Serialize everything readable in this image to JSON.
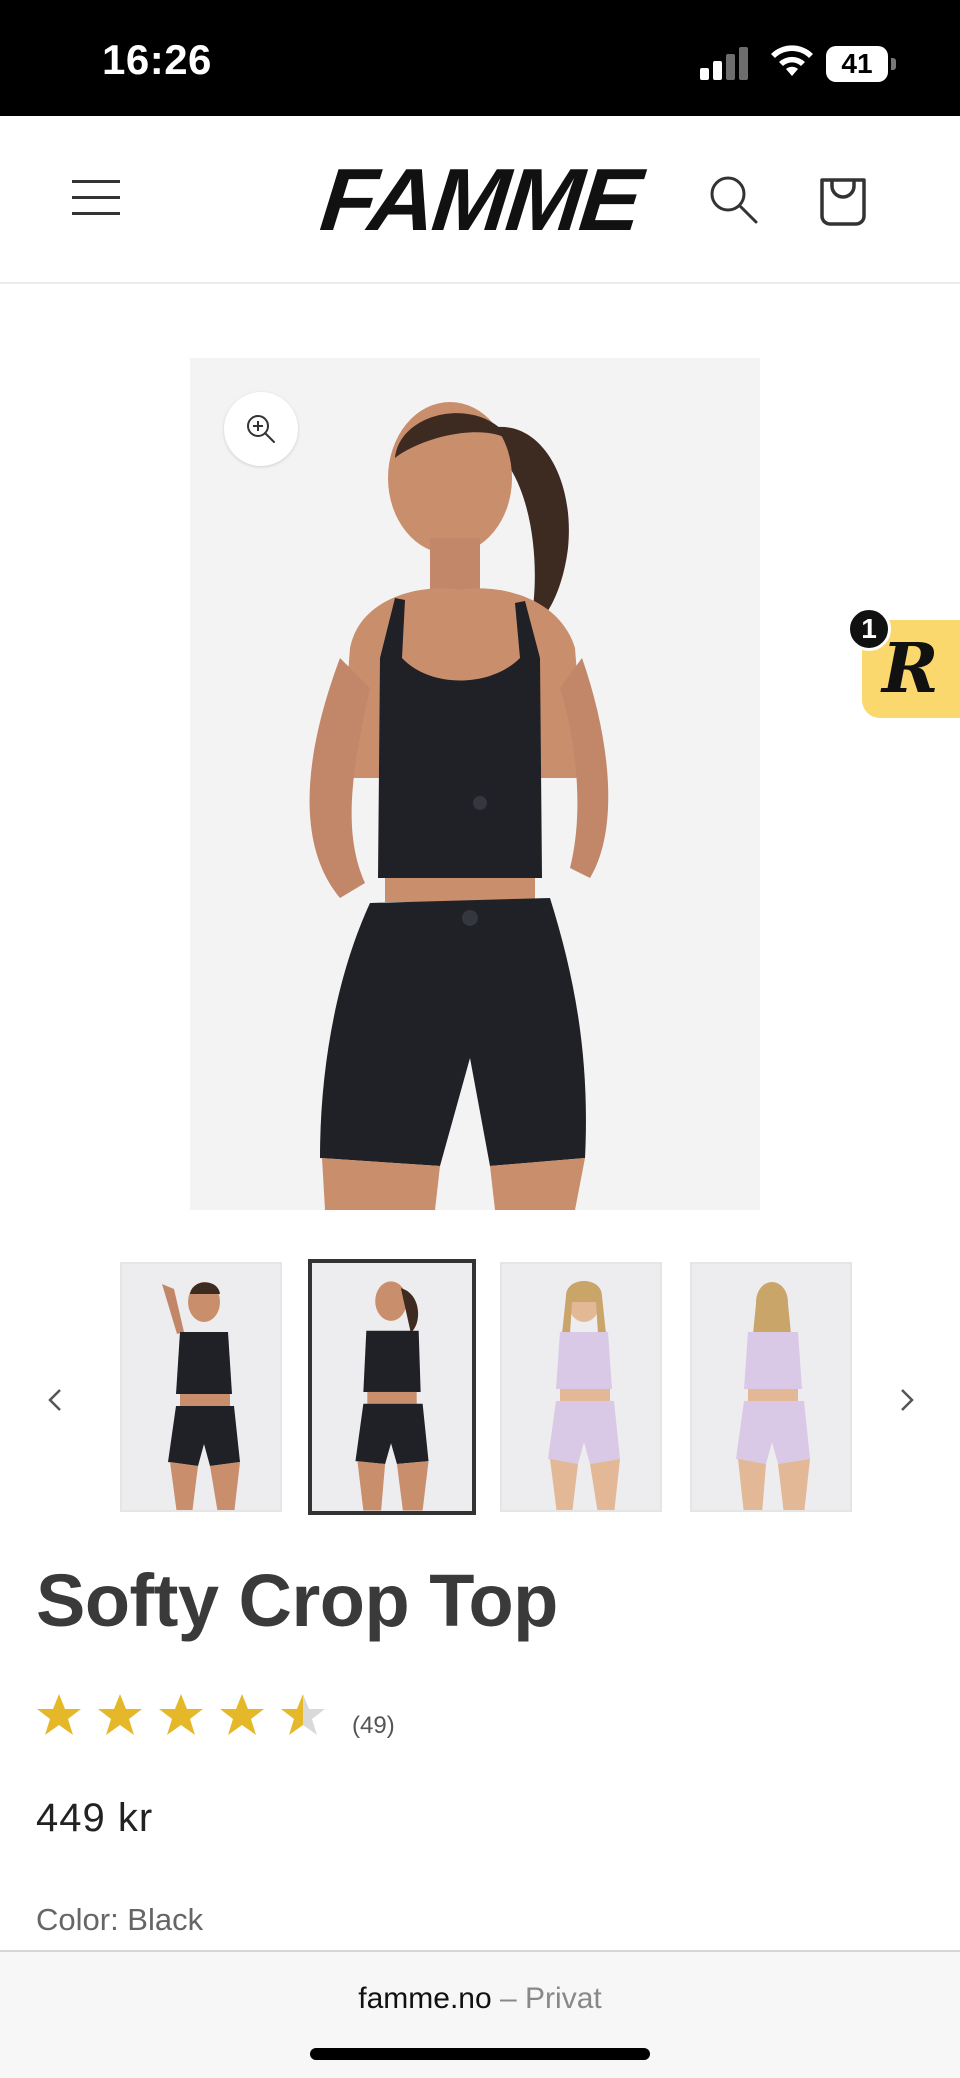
{
  "status_bar": {
    "time": "16:26",
    "battery": "41",
    "icons": [
      "signal-icon",
      "wifi-icon",
      "battery-icon"
    ]
  },
  "header": {
    "logo": "FAMME",
    "icons": [
      "menu-icon",
      "search-icon",
      "cart-icon"
    ]
  },
  "product": {
    "image_icon": "zoom-in-icon",
    "thumbnails": [
      {
        "name": "black-set-front",
        "color": "#1f2126"
      },
      {
        "name": "black-set-back",
        "color": "#1f2126",
        "selected": true
      },
      {
        "name": "lilac-set-front",
        "color": "#d9c8e6"
      },
      {
        "name": "lilac-set-back",
        "color": "#d9c8e6"
      }
    ],
    "title": "Softy Crop Top",
    "rating": 4.5,
    "review_count": "(49)",
    "price": "449 kr",
    "color_label": "Color: Black"
  },
  "reward_badge": {
    "letter": "R",
    "count": "1",
    "color": "#fbd86e"
  },
  "browser": {
    "domain": "famme.no",
    "separator": "–",
    "mode": "Privat"
  },
  "colors": {
    "star": "#e4b829",
    "star_empty": "#d9d9d9",
    "garment_black": "#1f2126",
    "garment_lilac": "#d9c8e6"
  }
}
